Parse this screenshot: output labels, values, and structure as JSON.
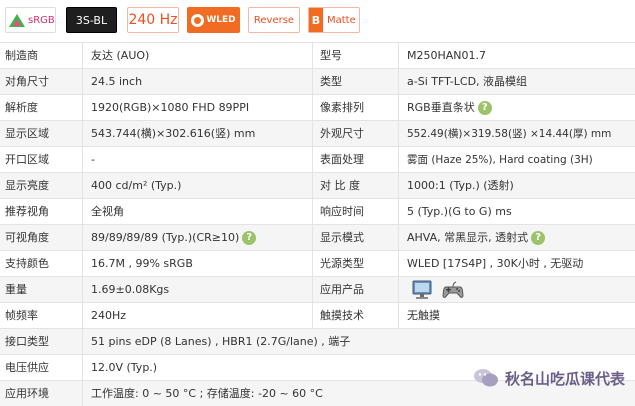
{
  "badges": {
    "srgb": "sRGB",
    "backlight": "3S-BL",
    "refresh": "240 Hz",
    "wled": "WLED",
    "reverse": "Reverse",
    "matte_icon": "B",
    "matte": "Matte"
  },
  "rows": [
    {
      "l1": "制造商",
      "v1": "友达 (AUO)",
      "l2": "型号",
      "v2": "M250HAN01.7"
    },
    {
      "l1": "对角尺寸",
      "v1": "24.5 inch",
      "l2": "类型",
      "v2": "a-Si TFT-LCD, 液晶模组"
    },
    {
      "l1": "解析度",
      "v1": "1920(RGB)×1080   FHD   89PPI",
      "l2": "像素排列",
      "v2": "RGB垂直条状"
    },
    {
      "l1": "显示区域",
      "v1": "543.744(横)×302.616(竖) mm",
      "l2": "外观尺寸",
      "v2": "552.49(横)×319.58(竖) ×14.44(厚) mm"
    },
    {
      "l1": "开口区域",
      "v1": "-",
      "l2": "表面处理",
      "v2": "雾面 (Haze 25%), Hard coating (3H)"
    },
    {
      "l1": "显示亮度",
      "v1": "400 cd/m² (Typ.)",
      "l2": "对 比 度",
      "v2": "1000:1 (Typ.) (透射)"
    },
    {
      "l1": "推荐视角",
      "v1": "全视角",
      "l2": "响应时间",
      "v2": "5 (Typ.)(G to G) ms"
    },
    {
      "l1": "可视角度",
      "v1": "89/89/89/89 (Typ.)(CR≥10)",
      "l2": "显示模式",
      "v2": "AHVA, 常黑显示, 透射式"
    },
    {
      "l1": "支持颜色",
      "v1": "16.7M , 99% sRGB",
      "l2": "光源类型",
      "v2": "WLED  [17S4P] , 30K小时 , 无驱动"
    },
    {
      "l1": "重量",
      "v1": "1.69±0.08Kgs",
      "l2": "应用产品",
      "v2": ""
    },
    {
      "l1": "帧频率",
      "v1": "240Hz",
      "l2": "触摸技术",
      "v2": "无触摸"
    },
    {
      "l1": "接口类型",
      "v1": "51 pins   eDP (8 Lanes) , HBR1 (2.7G/lane) , 端子"
    },
    {
      "l1": "电压供应",
      "v1": "12.0V (Typ.)"
    },
    {
      "l1": "应用环境",
      "v1": "工作温度: 0 ~ 50 °C ; 存储温度: -20 ~ 60 °C"
    }
  ],
  "help_glyph": "?",
  "application_icons": [
    "monitor-icon",
    "gamepad-icon"
  ],
  "watermark": "秋名山吃瓜课代表",
  "colors": {
    "accent": "#ef4e1f",
    "help_green": "#9cc36a",
    "row_alt": "#f5f5f5",
    "border": "#e3e3e3"
  }
}
